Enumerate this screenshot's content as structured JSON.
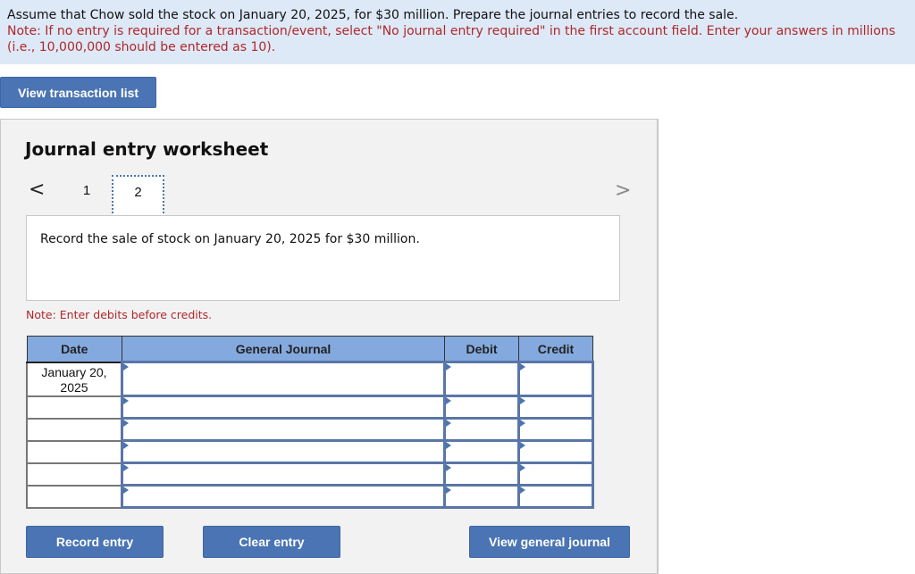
{
  "banner": {
    "question": "Assume that Chow sold the stock on January 20, 2025, for $30 million. Prepare the journal entries to record the sale.",
    "note": "Note: If no entry is required for a transaction/event, select \"No journal entry required\" in the first account field. Enter your answers in millions (i.e., 10,000,000 should be entered as 10)."
  },
  "buttons": {
    "view_transaction_list": "View transaction list",
    "record_entry": "Record entry",
    "clear_entry": "Clear entry",
    "view_general_journal": "View general journal"
  },
  "worksheet": {
    "title": "Journal entry worksheet",
    "prev_icon": "chevron-left-icon",
    "next_icon": "chevron-right-icon",
    "prev_glyph": "<",
    "next_glyph": ">",
    "tabs": [
      {
        "label": "1",
        "active": false
      },
      {
        "label": "2",
        "active": true
      }
    ],
    "description": "Record the sale of stock on January 20, 2025 for $30 million.",
    "note": "Note: Enter debits before credits."
  },
  "journal": {
    "headers": {
      "date": "Date",
      "account": "General Journal",
      "debit": "Debit",
      "credit": "Credit"
    },
    "rows": [
      {
        "date": "January 20, 2025",
        "account": "",
        "debit": "",
        "credit": ""
      },
      {
        "date": "",
        "account": "",
        "debit": "",
        "credit": ""
      },
      {
        "date": "",
        "account": "",
        "debit": "",
        "credit": ""
      },
      {
        "date": "",
        "account": "",
        "debit": "",
        "credit": ""
      },
      {
        "date": "",
        "account": "",
        "debit": "",
        "credit": ""
      },
      {
        "date": "",
        "account": "",
        "debit": "",
        "credit": ""
      }
    ]
  },
  "colors": {
    "accent": "#4a74b3",
    "note_red": "#b0272b",
    "header_blue": "#84a9de",
    "banner_bg": "#dde9f7"
  }
}
